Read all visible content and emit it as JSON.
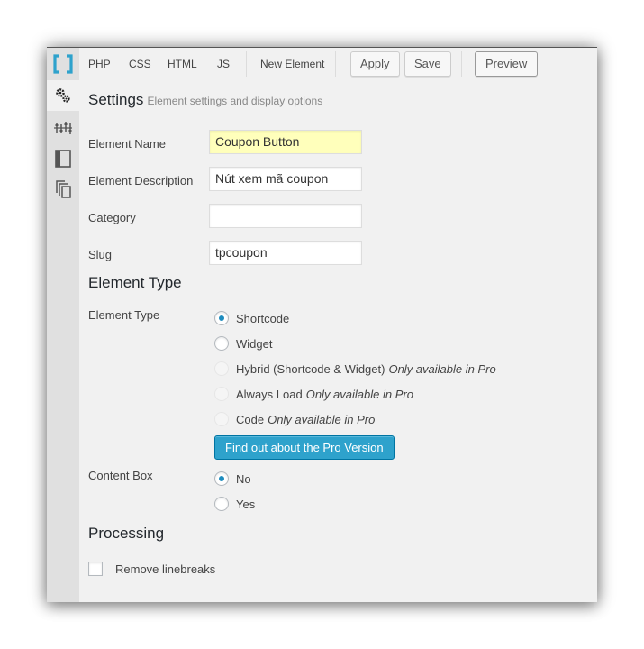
{
  "toolbar": {
    "tabs": [
      "PHP",
      "CSS",
      "HTML",
      "JS"
    ],
    "new_element": "New Element",
    "apply": "Apply",
    "save": "Save",
    "preview": "Preview"
  },
  "settings": {
    "title": "Settings",
    "subtitle": "Element settings and display options",
    "fields": {
      "name_label": "Element Name",
      "name_value": "Coupon Button",
      "description_label": "Element Description",
      "description_value": "Nút xem mã coupon",
      "category_label": "Category",
      "category_value": "",
      "slug_label": "Slug",
      "slug_value": "tpcoupon"
    }
  },
  "element_type": {
    "heading": "Element Type",
    "label": "Element Type",
    "options": [
      {
        "label": "Shortcode",
        "note": "",
        "checked": true,
        "disabled": false
      },
      {
        "label": "Widget",
        "note": "",
        "checked": false,
        "disabled": false
      },
      {
        "label": "Hybrid (Shortcode & Widget)",
        "note": "Only available in Pro",
        "checked": false,
        "disabled": true
      },
      {
        "label": "Always Load",
        "note": "Only available in Pro",
        "checked": false,
        "disabled": true
      },
      {
        "label": "Code",
        "note": "Only available in Pro",
        "checked": false,
        "disabled": true
      }
    ],
    "pro_button": "Find out about the Pro Version"
  },
  "content_box": {
    "label": "Content Box",
    "options": [
      {
        "label": "No",
        "checked": true
      },
      {
        "label": "Yes",
        "checked": false
      }
    ]
  },
  "processing": {
    "heading": "Processing",
    "remove_linebreaks": "Remove linebreaks",
    "remove_linebreaks_checked": false
  },
  "colors": {
    "accent": "#2ea2cc",
    "highlight_field": "#ffffbb",
    "logo_blue": "#2ea2cc"
  },
  "icons": [
    "bracket-logo-icon",
    "gears-icon",
    "sliders-icon",
    "panel-icon",
    "copy-icon"
  ]
}
